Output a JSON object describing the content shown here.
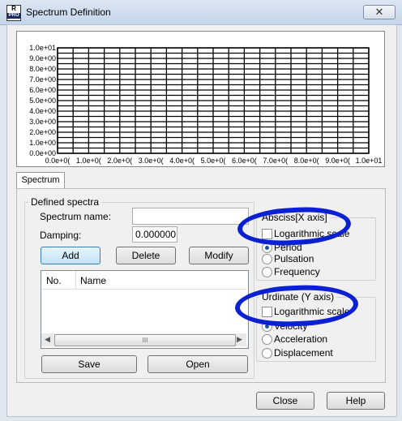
{
  "window": {
    "title": "Spectrum Definition",
    "icon_letters": "R",
    "icon_sub": "PRO",
    "close_glyph": "✕"
  },
  "chart_data": {
    "type": "line",
    "x_ticks": [
      "0.0e+0(",
      "1.0e+0(",
      "2.0e+0(",
      "3.0e+0(",
      "4.0e+0(",
      "5.0e+0(",
      "6.0e+0(",
      "7.0e+0(",
      "8.0e+0(",
      "9.0e+0(",
      "1.0e+01"
    ],
    "y_ticks": [
      "1.0e+01",
      "9.0e+00",
      "8.0e+00",
      "7.0e+00",
      "6.0e+00",
      "5.0e+00",
      "4.0e+00",
      "3.0e+00",
      "2.0e+00",
      "1.0e+00",
      "0.0e+00"
    ],
    "xlim": [
      0,
      10
    ],
    "ylim": [
      0,
      10
    ],
    "x_minor_per_major": 2,
    "y_minor_per_major": 2,
    "grid": true,
    "series": []
  },
  "tab": {
    "label": "Spectrum"
  },
  "defined": {
    "group_label": "Defined spectra",
    "name_label": "Spectrum name:",
    "name_value": "",
    "damping_label": "Damping:",
    "damping_value": "0.000000",
    "add": "Add",
    "delete": "Delete",
    "modify": "Modify",
    "col_no": "No.",
    "col_name": "Name",
    "scroll_grip": "III",
    "save": "Save",
    "open": "Open"
  },
  "abscissa": {
    "group_label": "Absciss[X axis]",
    "log_label": "Logarithmic scale",
    "log_checked": false,
    "options": [
      "Period",
      "Pulsation",
      "Frequency"
    ],
    "selected": 0
  },
  "ordinate": {
    "group_label": "Urdinate (Y axis)",
    "log_label": "Logarithmic scale",
    "log_checked": false,
    "options": [
      "Velocity",
      "Acceleration",
      "Displacement"
    ],
    "selected": 0
  },
  "footer": {
    "close": "Close",
    "help": "Help"
  },
  "annotations": {
    "color": "#0b20d0"
  }
}
